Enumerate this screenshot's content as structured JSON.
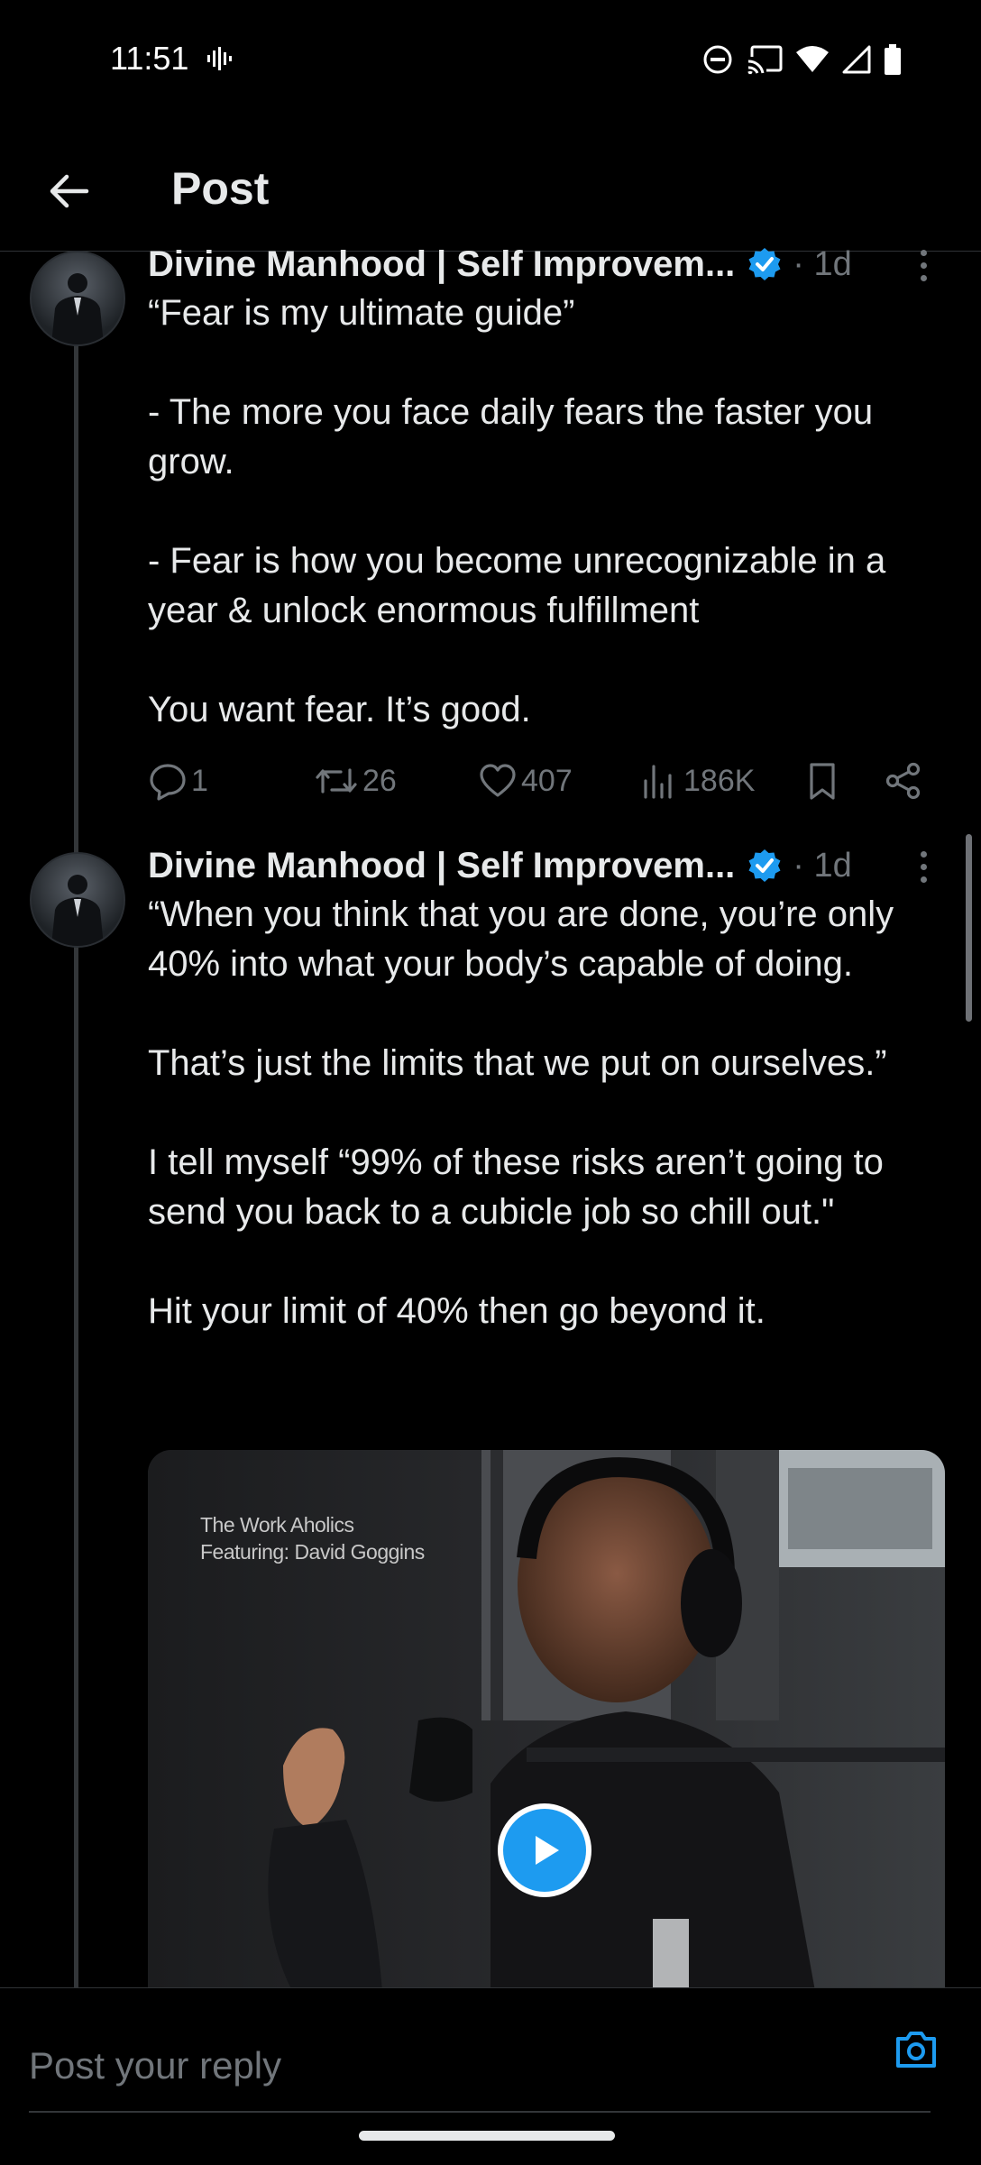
{
  "status": {
    "time": "11:51"
  },
  "header": {
    "title": "Post"
  },
  "posts": [
    {
      "author": "Divine Manhood | Self Improvem...",
      "time": "· 1d",
      "lines": [
        "“Fear is my ultimate guide”",
        "- The more you face daily fears the faster you grow.",
        "- Fear is how you become unrecognizable in a year & unlock enormous fulfillment",
        "You want fear. It’s good."
      ],
      "stats": {
        "replies": "1",
        "reposts": "26",
        "likes": "407",
        "views": "186K"
      }
    },
    {
      "author": "Divine Manhood | Self Improvem...",
      "time": "· 1d",
      "lines": [
        "“When you think that you are done, you’re only 40% into what your body’s capable of doing.",
        "That’s just the limits that we put on ourselves.”",
        "I tell myself “99% of these risks aren’t going to send you back to a cubicle job so chill out.\"",
        "Hit your limit of 40% then go beyond it."
      ],
      "media": {
        "caption_line1": "The Work Aholics",
        "caption_line2": "Featuring: David Goggins"
      }
    }
  ],
  "reply": {
    "placeholder": "Post your reply"
  },
  "colors": {
    "accent": "#1d9bf0",
    "background": "#000000",
    "muted": "#71767b"
  }
}
